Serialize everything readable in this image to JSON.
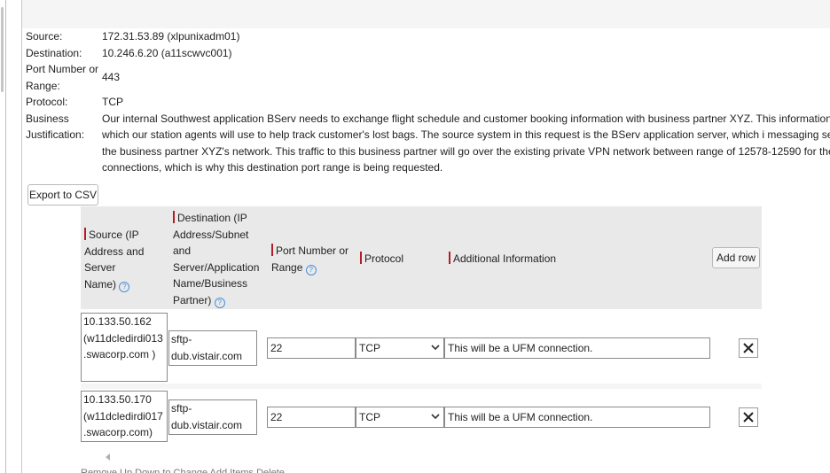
{
  "details": {
    "source_label": "Source:",
    "source_value": "172.31.53.89 (xlpunixadm01)",
    "destination_label": "Destination:",
    "destination_value": "10.246.6.20 (a11scwvc001)",
    "port_label_1": "Port Number or",
    "port_label_2": "Range:",
    "port_value": "443",
    "protocol_label": "Protocol:",
    "protocol_value": "TCP",
    "justification_label_1": "Business",
    "justification_label_2": "Justification:",
    "justification_value": "Our internal Southwest application BServ needs to exchange flight schedule and customer booking information with business partner XYZ. This information Application, which our station agents will use to help track customer's lost bags. The source system in this request is the BServ application server, which i messaging server located in the business partner XYZ's network. This traffic to this business partner will go over the existing private VPN network between range of 12578-12590 for these connections, which is why this destination port range is being requested."
  },
  "toolbar": {
    "export_label": "Export to CSV",
    "add_row_label": "Add row"
  },
  "grid": {
    "headers": {
      "source": [
        "Source (IP",
        "Address and",
        "Server",
        "Name)"
      ],
      "destination": [
        "Destination (IP",
        "Address/Subnet",
        "and",
        "Server/Application",
        "Name/Business",
        "Partner)"
      ],
      "port": [
        "Port Number or",
        "Range"
      ],
      "protocol": "Protocol",
      "additional": "Additional Information"
    },
    "rows": [
      {
        "source": [
          "10.133.50.162",
          "(w11dcledirdi013",
          ".swacorp.com )"
        ],
        "destination": [
          "sftp-",
          "dub.vistair.com"
        ],
        "port": "22",
        "protocol": "TCP",
        "additional": "This will be a UFM connection."
      },
      {
        "source": [
          "10.133.50.170",
          "(w11dcledirdi017",
          ".swacorp.com)"
        ],
        "destination": [
          "sftp-",
          "dub.vistair.com"
        ],
        "port": "22",
        "protocol": "TCP",
        "additional": "This will be a UFM connection."
      }
    ]
  },
  "footer_cut_text": "Remove    Up    Down    to    Change    Add Items    Delete"
}
